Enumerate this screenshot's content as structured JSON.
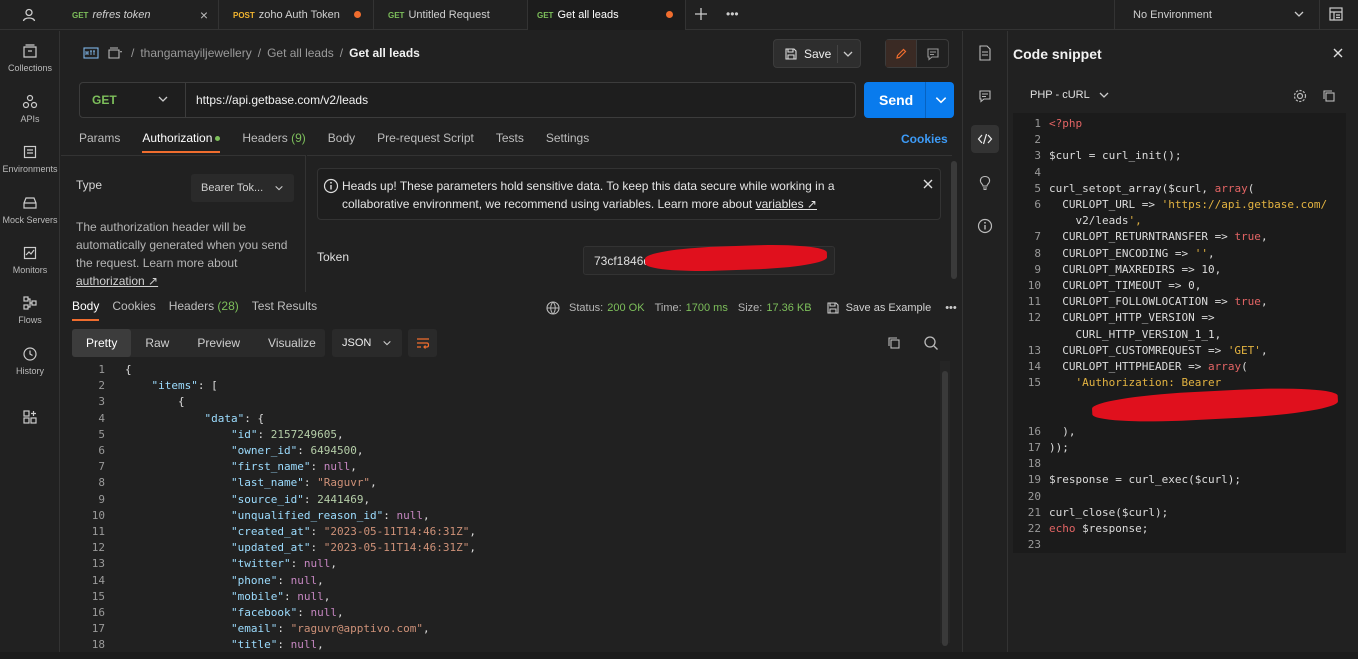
{
  "tabs": [
    {
      "method": "GET",
      "title": "refres token",
      "state": "close"
    },
    {
      "method": "POST",
      "title": "zoho Auth Token",
      "state": "dot"
    },
    {
      "method": "GET",
      "title": "Untitled Request",
      "state": "none"
    },
    {
      "method": "GET",
      "title": "Get all leads",
      "state": "dot"
    }
  ],
  "environment": "No Environment",
  "sidebar": [
    {
      "label": "Collections",
      "icon": "collections-icon"
    },
    {
      "label": "APIs",
      "icon": "apis-icon"
    },
    {
      "label": "Environments",
      "icon": "environments-icon"
    },
    {
      "label": "Mock Servers",
      "icon": "mock-servers-icon"
    },
    {
      "label": "Monitors",
      "icon": "monitors-icon"
    },
    {
      "label": "Flows",
      "icon": "flows-icon"
    },
    {
      "label": "History",
      "icon": "history-icon"
    }
  ],
  "breadcrumb": {
    "workspace": "thangamayiljewellery",
    "collection": "Get all leads",
    "request": "Get all leads"
  },
  "save_label": "Save",
  "method": "GET",
  "url": "https://api.getbase.com/v2/leads",
  "send_label": "Send",
  "request_tabs": {
    "params": "Params",
    "authorization": "Authorization",
    "headers": "Headers",
    "headers_count": "(9)",
    "body": "Body",
    "prerequest": "Pre-request Script",
    "tests": "Tests",
    "settings": "Settings"
  },
  "cookies_label": "Cookies",
  "auth": {
    "type_label": "Type",
    "type_value": "Bearer Tok...",
    "description": "The authorization header will be automatically generated when you send the request. Learn more about",
    "description_link": "authorization ↗",
    "alert_text": "Heads up! These parameters hold sensitive data. To keep this data secure while working in a collaborative environment, we recommend using variables. Learn more about",
    "alert_link": "variables ↗",
    "token_label": "Token",
    "token_value": "73cf1846d"
  },
  "response": {
    "tabs": {
      "body": "Body",
      "cookies": "Cookies",
      "headers": "Headers",
      "headers_count": "(28)",
      "tests": "Test Results"
    },
    "status_label": "Status:",
    "status_value": "200 OK",
    "time_label": "Time:",
    "time_value": "1700 ms",
    "size_label": "Size:",
    "size_value": "17.36 KB",
    "save_example": "Save as Example",
    "views": [
      "Pretty",
      "Raw",
      "Preview",
      "Visualize"
    ],
    "format": "JSON"
  },
  "body_lines": [
    "{",
    "    \"items\": [",
    "        {",
    "            \"data\": {",
    "                \"id\": 2157249605,",
    "                \"owner_id\": 6494500,",
    "                \"first_name\": null,",
    "                \"last_name\": \"Raguvr\",",
    "                \"source_id\": 2441469,",
    "                \"unqualified_reason_id\": null,",
    "                \"created_at\": \"2023-05-11T14:46:31Z\",",
    "                \"updated_at\": \"2023-05-11T14:46:31Z\",",
    "                \"twitter\": null,",
    "                \"phone\": null,",
    "                \"mobile\": null,",
    "                \"facebook\": null,",
    "                \"email\": \"raguvr@apptivo.com\",",
    "                \"title\": null,"
  ],
  "snippet": {
    "title": "Code snippet",
    "language": "PHP - cURL",
    "lines": [
      {
        "n": "1",
        "t": "<?php"
      },
      {
        "n": "2",
        "t": ""
      },
      {
        "n": "3",
        "t": "$curl = curl_init();"
      },
      {
        "n": "4",
        "t": ""
      },
      {
        "n": "5",
        "t": "curl_setopt_array($curl, array("
      },
      {
        "n": "6",
        "t": "  CURLOPT_URL => 'https://api.getbase.com/"
      },
      {
        "n": "",
        "t": "    v2/leads',"
      },
      {
        "n": "7",
        "t": "  CURLOPT_RETURNTRANSFER => true,"
      },
      {
        "n": "8",
        "t": "  CURLOPT_ENCODING => '',"
      },
      {
        "n": "9",
        "t": "  CURLOPT_MAXREDIRS => 10,"
      },
      {
        "n": "10",
        "t": "  CURLOPT_TIMEOUT => 0,"
      },
      {
        "n": "11",
        "t": "  CURLOPT_FOLLOWLOCATION => true,"
      },
      {
        "n": "12",
        "t": "  CURLOPT_HTTP_VERSION =>"
      },
      {
        "n": "",
        "t": "    CURL_HTTP_VERSION_1_1,"
      },
      {
        "n": "13",
        "t": "  CURLOPT_CUSTOMREQUEST => 'GET',"
      },
      {
        "n": "14",
        "t": "  CURLOPT_HTTPHEADER => array("
      },
      {
        "n": "15",
        "t": "    'Authorization: Bearer"
      },
      {
        "n": "",
        "t": ""
      },
      {
        "n": "",
        "t": ""
      },
      {
        "n": "16",
        "t": "  ),"
      },
      {
        "n": "17",
        "t": "));"
      },
      {
        "n": "18",
        "t": ""
      },
      {
        "n": "19",
        "t": "$response = curl_exec($curl);"
      },
      {
        "n": "20",
        "t": ""
      },
      {
        "n": "21",
        "t": "curl_close($curl);"
      },
      {
        "n": "22",
        "t": "echo $response;"
      },
      {
        "n": "23",
        "t": ""
      }
    ]
  }
}
